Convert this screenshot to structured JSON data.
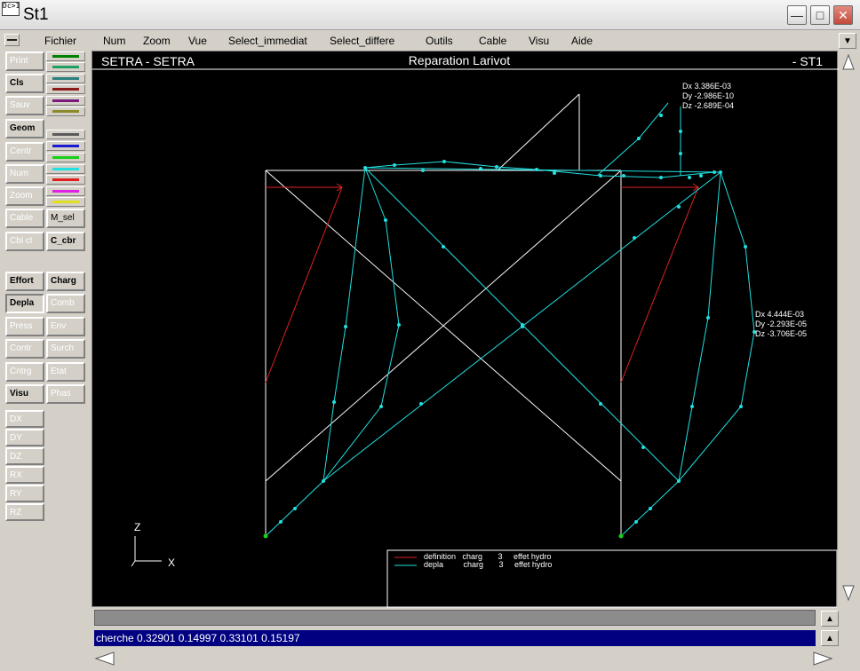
{
  "window": {
    "title": "St1",
    "icon_text": "Dc>1",
    "controls": [
      "minimize-icon",
      "maximize-icon",
      "close-icon"
    ]
  },
  "menu": {
    "items": [
      "Fichier",
      "Num",
      "Zoom",
      "Vue",
      "Select_immediat",
      "Select_differe",
      "Outils",
      "Cable",
      "Visu",
      "Aide"
    ]
  },
  "toolbar": {
    "row1": [
      "Print",
      "Cls",
      "Sauv",
      "Geom",
      "Centr",
      "Num",
      "Zoom",
      "Cable",
      "Cbl ct"
    ],
    "row1_col2": [
      "M_sel",
      "C_cbr"
    ],
    "row2_left": [
      "Effort",
      "Depla",
      "Press",
      "Contr",
      "Cntrg",
      "Visu"
    ],
    "row2_right": [
      "Charg",
      "Comb",
      "Env",
      "Surch",
      "Etat",
      "Phas"
    ],
    "dofs": [
      "DX",
      "DY",
      "DZ",
      "RX",
      "RY",
      "RZ"
    ],
    "swatch_colors": [
      "#008000",
      "#1fa060",
      "#2a7f7f",
      "#8b1a1a",
      "#7a1a7a",
      "#8a8a2a",
      "#5a5a5a",
      "#1a1ad0",
      "#18d018",
      "#20e0e0",
      "#e02020",
      "#e020e0",
      "#e0e020"
    ]
  },
  "canvas": {
    "left_header": "SETRA  -  SETRA",
    "center_header": "Reparation Larivot",
    "right_header": "-  ST1",
    "axis_z": "Z",
    "axis_x": "X",
    "annot1": [
      "Dx  3.386E-03",
      "Dy -2.986E-10",
      "Dz -2.689E-04"
    ],
    "annot2": [
      "Dx  4.444E-03",
      "Dy -2.293E-05",
      "Dz -3.706E-05"
    ],
    "legend": [
      {
        "label": "definition   charg       3     effet hydro",
        "color": "#e02020"
      },
      {
        "label": "depla         charg       3     effet hydro",
        "color": "#20e0e0"
      }
    ]
  },
  "status": {
    "command": "cherche  0.32901  0.14997  0.33101  0.15197"
  }
}
